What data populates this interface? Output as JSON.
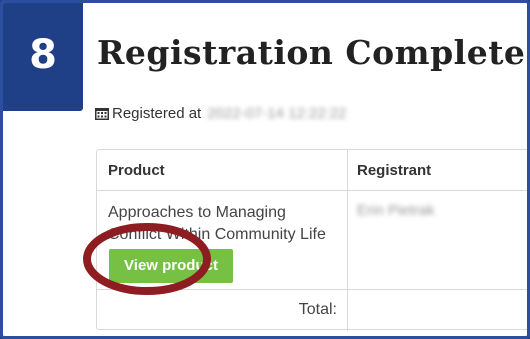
{
  "step": {
    "number": "8",
    "color": "#1f3f86"
  },
  "page": {
    "title": "Registration Complete"
  },
  "registered": {
    "icon": "calendar-icon",
    "label": "Registered at",
    "value": "2022-07-14 12:22:22"
  },
  "table": {
    "headers": [
      "Product",
      "Registrant"
    ],
    "rows": [
      {
        "product": "Approaches to Managing Conflict Within Community Life",
        "registrant": "Erin Pietrak",
        "action": "View product"
      }
    ],
    "total_label": "Total:"
  },
  "colors": {
    "accent_green": "#76c043",
    "highlight_red": "#8e1d21",
    "frame_blue": "#2b4f9c"
  }
}
